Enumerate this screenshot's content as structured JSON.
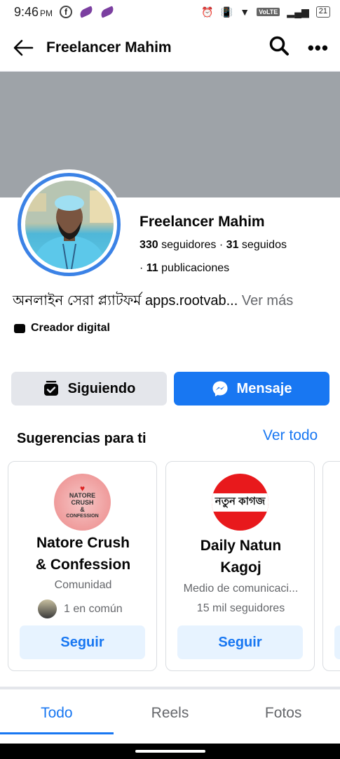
{
  "status_bar": {
    "time": "9:46",
    "ampm": "PM",
    "network": "VoLTE",
    "battery": "21"
  },
  "header": {
    "title": "Freelancer Mahim"
  },
  "profile": {
    "name": "Freelancer Mahim",
    "followers_count": "330",
    "followers_label": "seguidores",
    "following_count": "31",
    "following_label": "seguidos",
    "posts_count": "11",
    "posts_label": "publicaciones",
    "bio": "অনলাইন সেরা প্ল্যাটফর্ম  apps.rootvab...",
    "bio_more": "Ver más",
    "category": "Creador digital"
  },
  "actions": {
    "following_label": "Siguiendo",
    "message_label": "Mensaje"
  },
  "suggestions": {
    "title": "Sugerencias para ti",
    "see_all": "Ver todo",
    "cards": [
      {
        "name_line1": "Natore Crush",
        "name_line2": "& Confession",
        "subtitle": "Comunidad",
        "mutual": "1 en común",
        "logo_text": [
          "NATORE",
          "CRUSH",
          "&",
          "CONFESSION"
        ],
        "button": "Seguir"
      },
      {
        "name_line1": "Daily Natun",
        "name_line2": "Kagoj",
        "subtitle": "Medio de comunicaci...",
        "followers": "15 mil seguidores",
        "logo_text": "নতুন কাগজ",
        "button": "Seguir"
      }
    ]
  },
  "tabs": [
    {
      "label": "Todo",
      "active": true
    },
    {
      "label": "Reels",
      "active": false
    },
    {
      "label": "Fotos",
      "active": false
    }
  ],
  "colors": {
    "accent": "#1877f2",
    "cover": "#9ea3a8",
    "avatar_ring": "#3b82e6"
  }
}
